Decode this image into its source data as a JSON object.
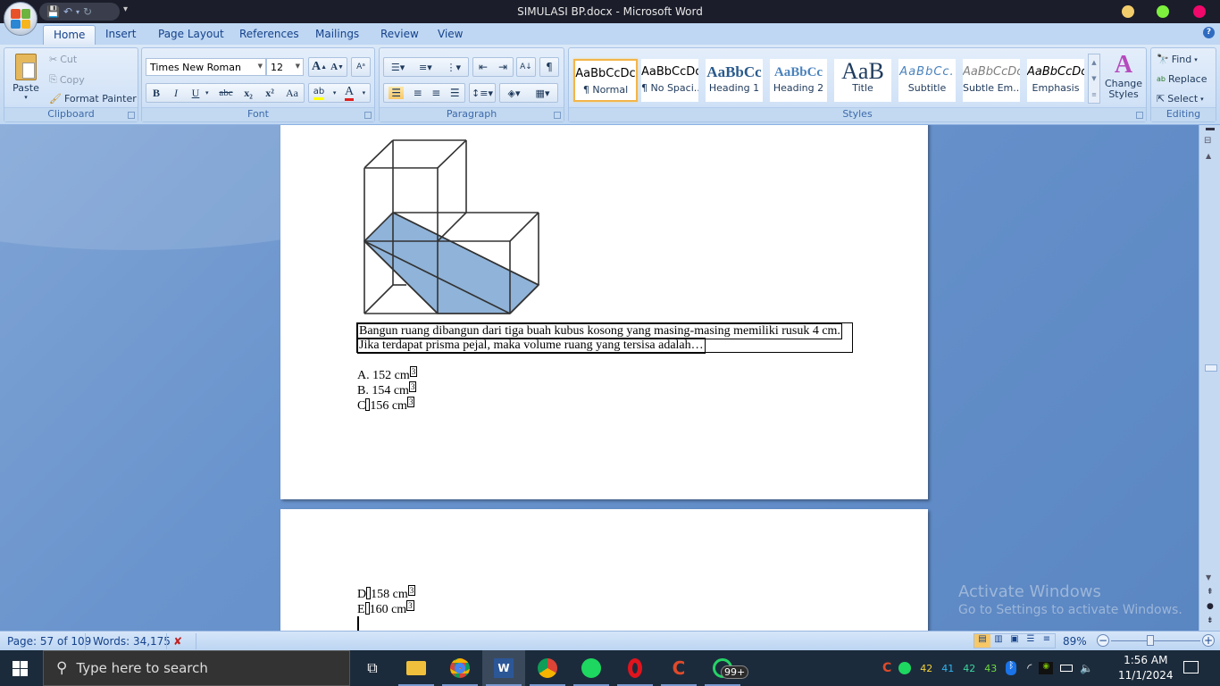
{
  "window": {
    "title": "SIMULASI BP.docx - Microsoft Word",
    "controls": [
      {
        "name": "minimize",
        "color": "#f2cd6b"
      },
      {
        "name": "maximize",
        "color": "#7df13d"
      },
      {
        "name": "close",
        "color": "#f0086a"
      }
    ]
  },
  "quick_access": {
    "save": "save-icon",
    "undo": "undo-icon",
    "redo": "redo-icon",
    "customize": "▾"
  },
  "tabs": [
    {
      "label": "Home",
      "active": true
    },
    {
      "label": "Insert"
    },
    {
      "label": "Page Layout"
    },
    {
      "label": "References"
    },
    {
      "label": "Mailings"
    },
    {
      "label": "Review"
    },
    {
      "label": "View"
    }
  ],
  "ribbon": {
    "clipboard": {
      "label": "Clipboard",
      "paste": "Paste",
      "cut": "Cut",
      "copy": "Copy",
      "format_painter": "Format Painter"
    },
    "font": {
      "label": "Font",
      "font_name": "Times New Roman",
      "font_size": "12",
      "grow": "A",
      "shrink": "A",
      "bold": "B",
      "italic": "I",
      "underline": "U",
      "strikethrough": "abc",
      "subscript": "x₂",
      "superscript": "x²",
      "change_case": "Aa",
      "highlight_color": "#ffff00",
      "font_color": "#e02020"
    },
    "paragraph": {
      "label": "Paragraph",
      "show_marks": "¶"
    },
    "styles": {
      "label": "Styles",
      "items": [
        {
          "sample": "AaBbCcDc",
          "name": "¶ Normal",
          "selected": true
        },
        {
          "sample": "AaBbCcDc",
          "name": "¶ No Spaci..."
        },
        {
          "sample": "AaBbCc",
          "name": "Heading 1"
        },
        {
          "sample": "AaBbCc",
          "name": "Heading 2"
        },
        {
          "sample": "AaB",
          "name": "Title"
        },
        {
          "sample": "AaBbCc.",
          "name": "Subtitle"
        },
        {
          "sample": "AaBbCcDc",
          "name": "Subtle Em..."
        },
        {
          "sample": "AaBbCcDc",
          "name": "Emphasis"
        }
      ],
      "change_styles": "Change Styles"
    },
    "editing": {
      "label": "Editing",
      "find": "Find",
      "replace": "Replace",
      "select": "Select"
    }
  },
  "document": {
    "question_line1": "Bangun ruang dibangun dari tiga buah kubus kosong yang masing-masing memiliki rusuk 4 cm.",
    "question_line2": "Jika terdapat prisma pejal, maka volume ruang yang tersisa adalah…",
    "options": [
      {
        "letter": "A.",
        "value": "152 cm",
        "sup": "3"
      },
      {
        "letter": "B.",
        "value": "154 cm",
        "sup": "3"
      },
      {
        "letter": "C",
        "value": "156 cm",
        "sup": "3"
      },
      {
        "letter": "D",
        "value": "158 cm",
        "sup": "3"
      },
      {
        "letter": "E",
        "value": "160 cm",
        "sup": "3"
      }
    ],
    "figure_fill": "#8fb3d9"
  },
  "watermark": {
    "title": "Activate Windows",
    "subtitle": "Go to Settings to activate Windows."
  },
  "status": {
    "page": "Page: 57 of 109",
    "words": "Words: 34,175",
    "zoom": "89%",
    "zoom_level_percent": 89
  },
  "taskbar": {
    "search_placeholder": "Type here to search",
    "apps": [
      "task-view",
      "file-explorer",
      "chrome-profile-a",
      "microsoft-word",
      "chrome-profile-b",
      "spotify",
      "opera",
      "ccleaner",
      "whatsapp"
    ],
    "whatsapp_badge": "99+",
    "tray_numbers": [
      {
        "value": "42",
        "color": "#f5d33b"
      },
      {
        "value": "41",
        "color": "#31b4f0"
      },
      {
        "value": "42",
        "color": "#3cd6a0"
      },
      {
        "value": "43",
        "color": "#6cdc3c"
      }
    ],
    "time": "1:56 AM",
    "date": "11/1/2024"
  }
}
